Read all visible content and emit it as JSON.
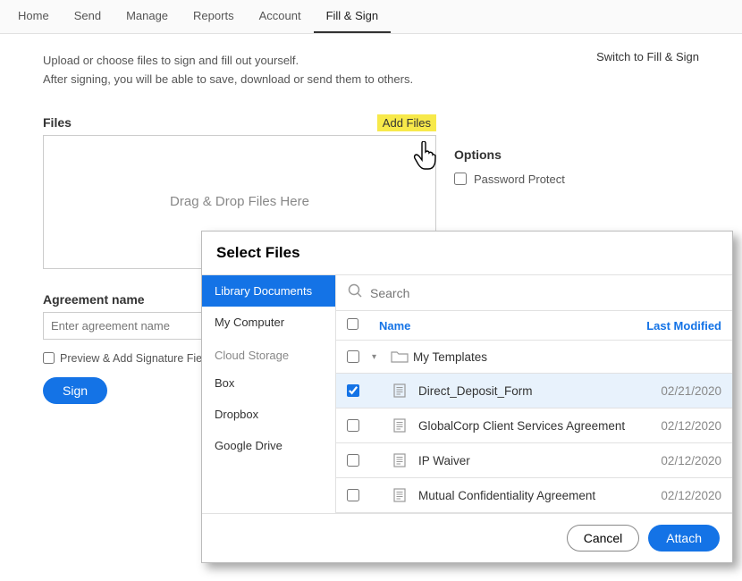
{
  "nav": {
    "items": [
      "Home",
      "Send",
      "Manage",
      "Reports",
      "Account",
      "Fill & Sign"
    ],
    "active": 5
  },
  "switch_link": "Switch to Fill & Sign",
  "intro_line1": "Upload or choose files to sign and fill out yourself.",
  "intro_line2": "After signing, you will be able to save, download or send them to others.",
  "files_label": "Files",
  "add_files": "Add Files",
  "dropzone": "Drag & Drop Files Here",
  "options": {
    "title": "Options",
    "password_protect": "Password Protect"
  },
  "agreement": {
    "label": "Agreement name",
    "placeholder": "Enter agreement name",
    "preview_label": "Preview & Add Signature Field",
    "sign": "Sign"
  },
  "dialog": {
    "title": "Select Files",
    "sidebar": {
      "items": [
        "Library Documents",
        "My Computer"
      ],
      "heading": "Cloud Storage",
      "cloud": [
        "Box",
        "Dropbox",
        "Google Drive"
      ],
      "selected": 0
    },
    "search_placeholder": "Search",
    "columns": {
      "name": "Name",
      "modified": "Last Modified"
    },
    "folder": "My Templates",
    "rows": [
      {
        "name": "Direct_Deposit_Form",
        "date": "02/21/2020",
        "checked": true
      },
      {
        "name": "GlobalCorp Client Services Agreement",
        "date": "02/12/2020",
        "checked": false
      },
      {
        "name": "IP Waiver",
        "date": "02/12/2020",
        "checked": false
      },
      {
        "name": "Mutual Confidentiality Agreement",
        "date": "02/12/2020",
        "checked": false
      }
    ],
    "cancel": "Cancel",
    "attach": "Attach"
  }
}
